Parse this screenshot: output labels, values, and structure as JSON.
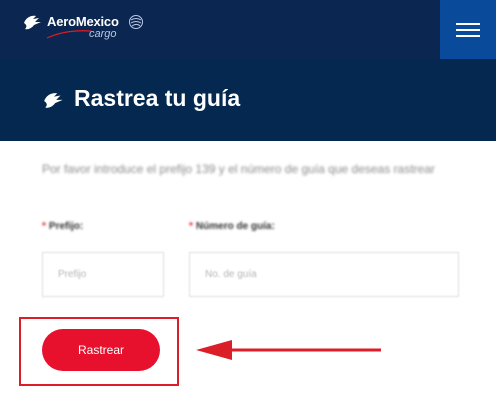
{
  "header": {
    "brand": "AeroMexico",
    "brand_sub": "cargo",
    "logo_icon": "eagle-knight-icon",
    "alliance_icon": "skyteam-icon",
    "menu_icon": "hamburger-icon",
    "colors": {
      "nav": "#0b2650",
      "menu_button": "#0a4a9a"
    }
  },
  "titlebar": {
    "title": "Rastrea tu guía",
    "icon": "eagle-knight-icon",
    "color": "#04284f"
  },
  "form": {
    "instructions": "Por favor introduce el prefijo 139 y el número de guía que deseas rastrear",
    "required_mark": "*",
    "prefix_label": "Prefijo:",
    "prefix_placeholder": "Prefijo",
    "guide_label": "Número de guía:",
    "guide_placeholder": "No. de guía",
    "submit_label": "Rastrear",
    "accent": "#e8112d"
  },
  "annotation": {
    "color": "#dc1e28"
  }
}
